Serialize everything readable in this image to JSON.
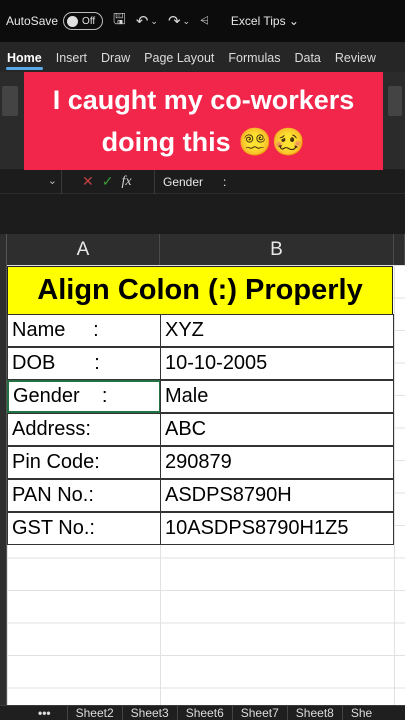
{
  "titlebar": {
    "autosave_label": "AutoSave",
    "autosave_state": "Off",
    "document_title": "Excel Tips ⌄"
  },
  "ribbon_tabs": [
    "Home",
    "Insert",
    "Draw",
    "Page Layout",
    "Formulas",
    "Data",
    "Review"
  ],
  "banner": {
    "line1": "I caught my co-workers",
    "line2": "doing this 😵‍💫🥴"
  },
  "formula_bar": {
    "content": "Gender      :"
  },
  "columns": [
    "A",
    "B"
  ],
  "sheet": {
    "title": "Align Colon (:) Properly",
    "rows": [
      {
        "a": "Name     :",
        "b": "XYZ"
      },
      {
        "a": "DOB       :",
        "b": "10-10-2005"
      },
      {
        "a": "Gender    :",
        "b": "Male"
      },
      {
        "a": "Address:",
        "b": "ABC"
      },
      {
        "a": "Pin Code:",
        "b": "290879"
      },
      {
        "a": "PAN No.:",
        "b": "ASDPS8790H"
      },
      {
        "a": "GST No.:",
        "b": "10ASDPS8790H1Z5"
      }
    ]
  },
  "sheet_tabs": {
    "more_label": "•••",
    "tabs": [
      "Sheet2",
      "Sheet3",
      "Sheet6",
      "Sheet7",
      "Sheet8",
      "She"
    ]
  },
  "colors": {
    "banner": "#f2254a",
    "title_fill": "#ffff00",
    "active_tab_underline": "#5aa9e6",
    "selection": "#217346"
  }
}
